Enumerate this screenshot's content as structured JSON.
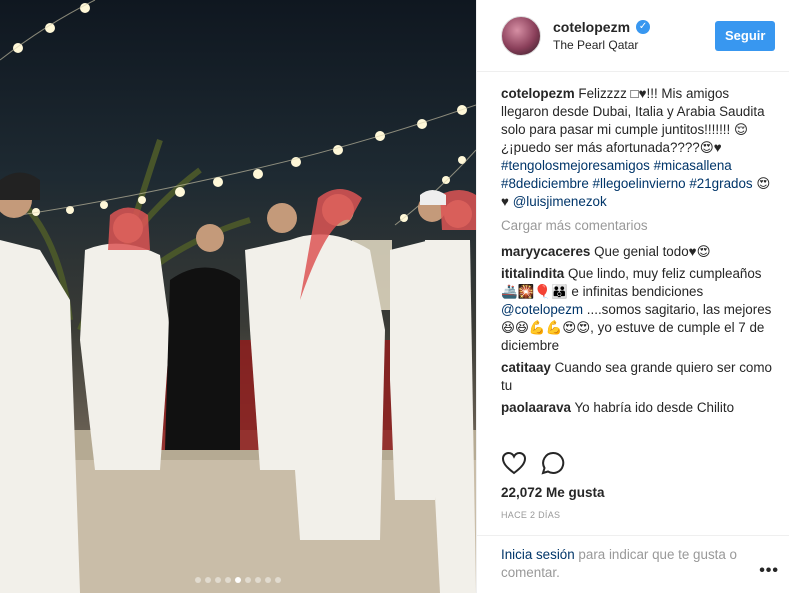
{
  "header": {
    "username": "cotelopezm",
    "location": "The Pearl Qatar",
    "follow_label": "Seguir"
  },
  "caption": {
    "username": "cotelopezm",
    "text": "Felizzzz □♥!!! Mis amigos llegaron desde Dubai, Italia y Arabia Saudita solo para pasar mi cumple juntitos!!!!!!! 😌 ¿¡puedo ser más afortunada????😍♥",
    "hashtags": "#tengolosmejoresamigos #micasallena #8dediciembre #llegoelinvierno #21grados",
    "end_emoji": "😍♥",
    "mention": "@luisjimenezok"
  },
  "load_more": "Cargar más comentarios",
  "comments": [
    {
      "user": "maryycaceres",
      "text": "Que genial todo♥😍"
    },
    {
      "user": "ititalindita",
      "text": "Que lindo, muy feliz cumpleaños 🚢🎇🎈👪 e infinitas bendiciones ",
      "mention": "@cotelopezm",
      "text2": " ....somos sagitario, las mejores😆😆💪💪😍😍, yo estuve de cumple el 7 de diciembre"
    },
    {
      "user": "catitaay",
      "text": "Cuando sea grande quiero ser como tu"
    },
    {
      "user": "paolaarava",
      "text": "Yo habría ido desde Chilito"
    }
  ],
  "likes": "22,072 Me gusta",
  "time_ago": "HACE 2 DÍAS",
  "login_prompt": {
    "link": "Inicia sesión",
    "text": " para indicar que te gusta o comentar."
  },
  "more_options": "•••",
  "carousel": {
    "count": 9,
    "active_index": 4
  },
  "colors": {
    "accent": "#3897f0",
    "link": "#003569",
    "muted": "#999999"
  },
  "icons": [
    "heart-icon",
    "comment-icon",
    "verified-badge-icon",
    "more-options-icon"
  ]
}
